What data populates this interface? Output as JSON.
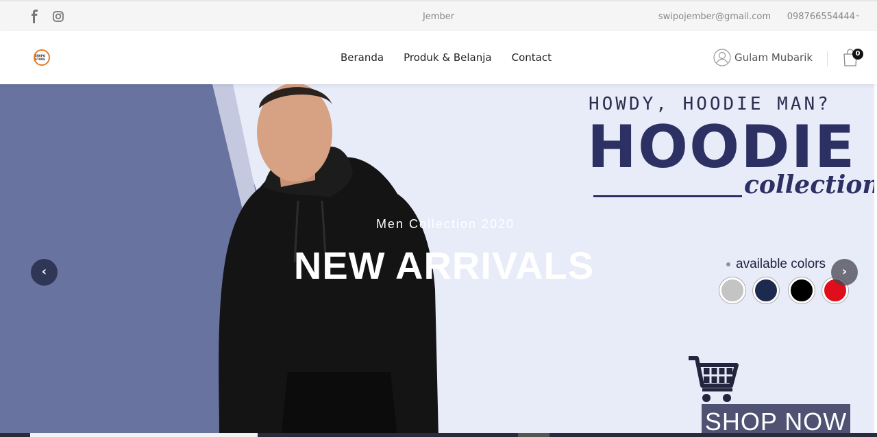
{
  "topbar": {
    "social_icons": [
      "facebook-icon",
      "instagram-icon"
    ],
    "city": "Jember",
    "email": "swipojember@gmail.com",
    "phone": "098766554444"
  },
  "header": {
    "logo_text": "SWIPO STORE",
    "nav": [
      "Beranda",
      "Produk & Belanja",
      "Contact"
    ],
    "user_name": "Gulam Mubarik",
    "cart_count": "0"
  },
  "hero": {
    "tagline": "HOWDY, HOODIE MAN?",
    "headline": "HOODIE",
    "sub_headline": "collection",
    "slide_subtitle": "Men Collection 2020",
    "slide_title": "NEW ARRIVALS",
    "available_colors_label": "available colors",
    "colors": [
      "#c4c4c4",
      "#1d2a4f",
      "#000000",
      "#e00d1a"
    ],
    "shop_now": "SHOP NOW",
    "prev_arrow": "‹",
    "next_arrow": "›"
  }
}
